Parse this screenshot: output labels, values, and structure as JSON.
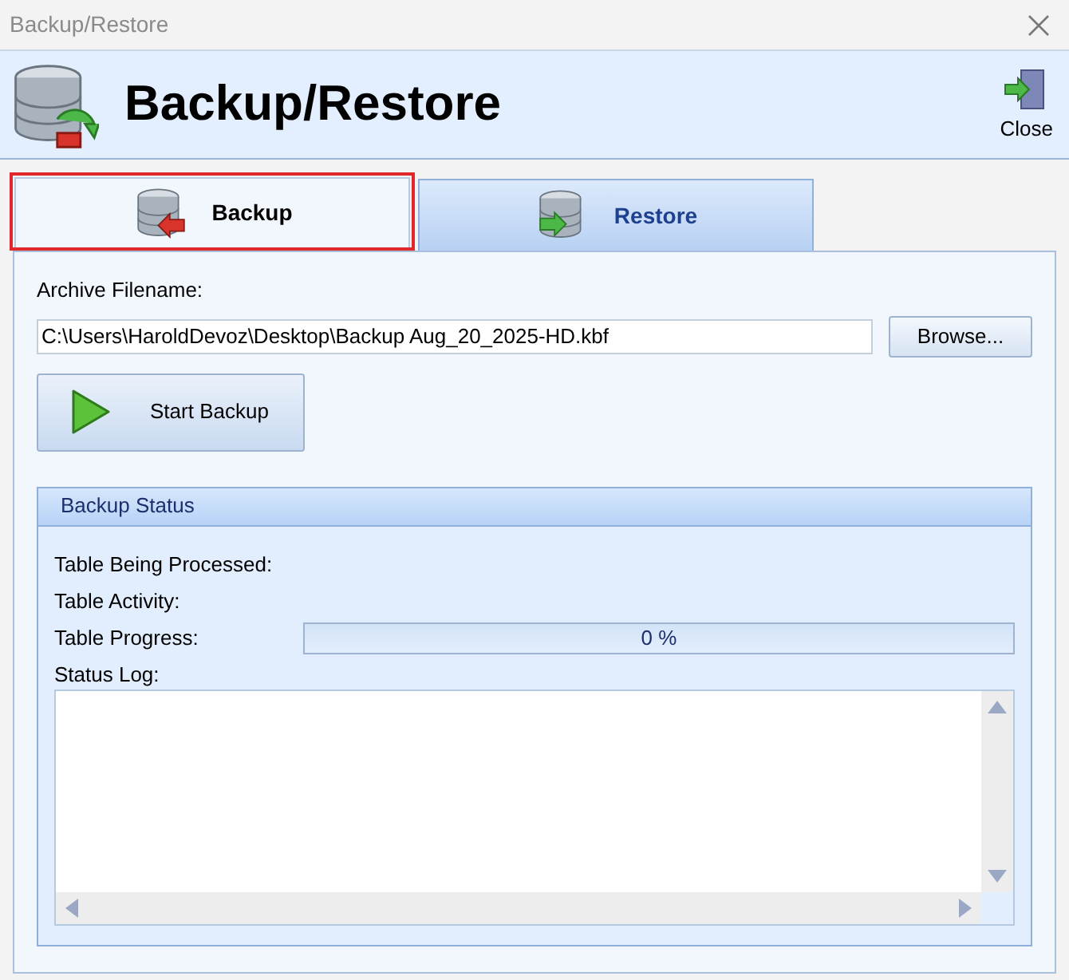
{
  "window": {
    "title": "Backup/Restore"
  },
  "header": {
    "title": "Backup/Restore",
    "close_label": "Close"
  },
  "tabs": [
    {
      "label": "Backup",
      "selected": true,
      "highlighted": true,
      "kind": "backup"
    },
    {
      "label": "Restore",
      "selected": false,
      "highlighted": false,
      "kind": "restore"
    }
  ],
  "archive": {
    "label": "Archive Filename:",
    "value": "C:\\Users\\HaroldDevoz\\Desktop\\Backup Aug_20_2025-HD.kbf",
    "browse": "Browse..."
  },
  "start_button": "Start Backup",
  "status": {
    "title": "Backup Status",
    "table_being_processed": "Table Being Processed:",
    "table_activity": "Table Activity:",
    "table_progress": "Table Progress:",
    "progress": {
      "level": 0,
      "reading": "0 %"
    },
    "status_log": "Status Log:"
  }
}
